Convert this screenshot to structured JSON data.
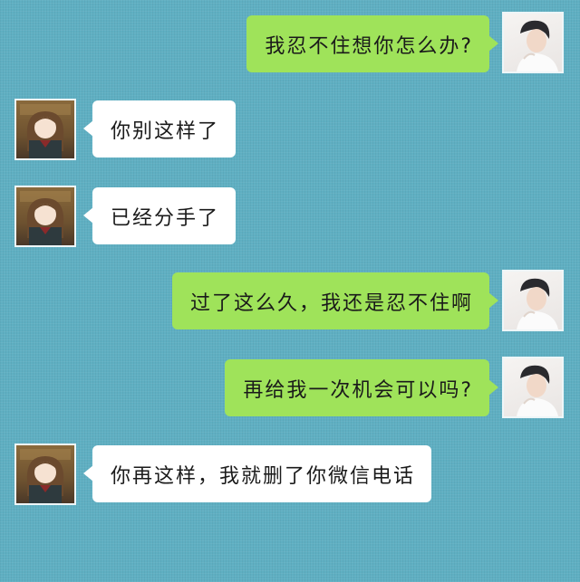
{
  "conversation": {
    "messages": [
      {
        "sender": "me",
        "text": "我忍不住想你怎么办?"
      },
      {
        "sender": "them",
        "text": "你别这样了"
      },
      {
        "sender": "them",
        "text": "已经分手了"
      },
      {
        "sender": "me",
        "text": "过了这么久，我还是忍不住啊"
      },
      {
        "sender": "me",
        "text": "再给我一次机会可以吗?"
      },
      {
        "sender": "them",
        "text": "你再这样，我就删了你微信电话"
      }
    ]
  },
  "colors": {
    "chat_background": "#5fafc2",
    "outgoing_bubble": "#9fe35a",
    "incoming_bubble": "#ffffff"
  },
  "icons": {
    "me_avatar": "boy-avatar-icon",
    "them_avatar": "girl-avatar-icon"
  }
}
